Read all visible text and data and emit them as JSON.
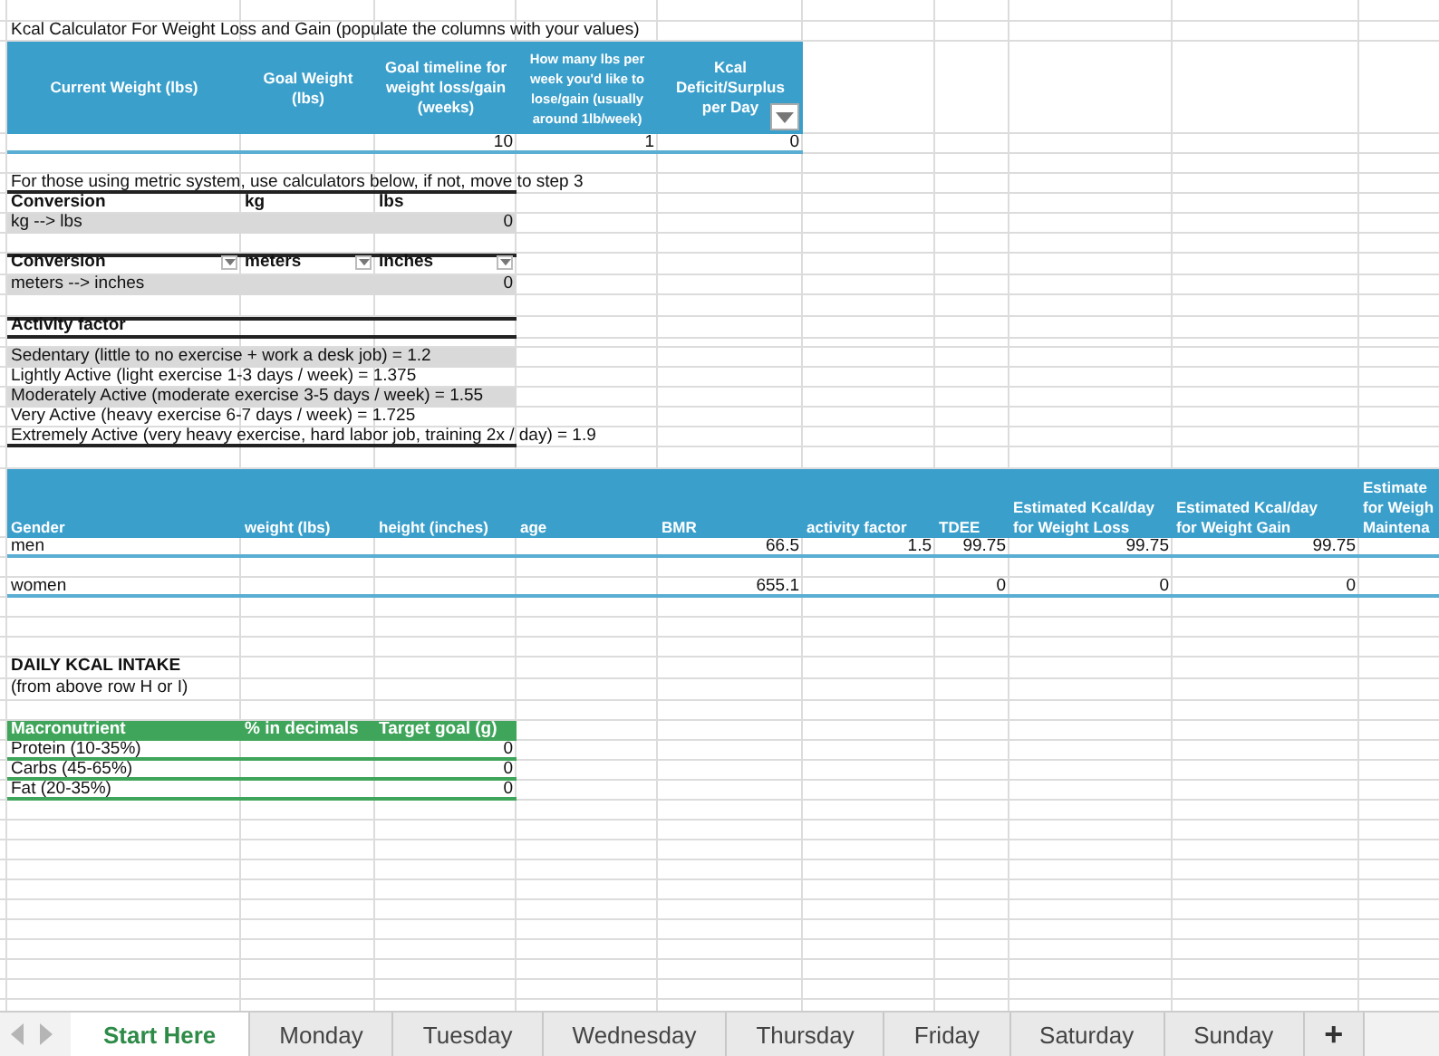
{
  "title": "Kcal Calculator For Weight Loss and Gain (populate the columns with your values)",
  "goal_table": {
    "columns": [
      {
        "label": "Current Weight (lbs)",
        "filter": false
      },
      {
        "label": "Goal Weight (lbs)",
        "filter": false
      },
      {
        "label": "Goal timeline for weight loss/gain (weeks)",
        "filter": false,
        "value": "10"
      },
      {
        "label": "How many lbs per week you'd like to lose/gain (usually around 1lb/week)",
        "filter": false,
        "value": "1"
      },
      {
        "label": "Kcal Deficit/Surplus per Day",
        "filter": true,
        "value": "0"
      }
    ]
  },
  "metric_note": "For those using metric system, use calculators below, if not, move to step 3",
  "conversions": [
    {
      "headers": [
        "Conversion",
        "kg",
        "lbs"
      ],
      "filters": false,
      "label": "kg --> lbs",
      "result": "0"
    },
    {
      "headers": [
        "Conversion",
        "meters",
        "inches"
      ],
      "filters": true,
      "label": "meters --> inches",
      "result": "0"
    }
  ],
  "activity": {
    "heading": "Activity factor",
    "levels": [
      {
        "text": "Sedentary (little to no exercise + work a desk job) = 1.2",
        "shaded": true
      },
      {
        "text": "Lightly Active (light exercise 1-3 days / week) = 1.375",
        "shaded": false
      },
      {
        "text": "Moderately Active (moderate exercise 3-5 days / week) = 1.55",
        "shaded": true
      },
      {
        "text": "Very Active (heavy exercise 6-7 days / week) = 1.725",
        "shaded": false
      },
      {
        "text": "Extremely Active (very heavy exercise, hard labor job, training 2x / day) = 1.9",
        "shaded": false
      }
    ]
  },
  "bmr_table": {
    "columns": [
      "Gender",
      "weight (lbs)",
      "height (inches)",
      "age",
      "BMR",
      "activity factor",
      "TDEE",
      "Estimated Kcal/day\nfor Weight Loss",
      "Estimated Kcal/day\nfor Weight Gain",
      "Estimate\nfor Weigh\nMaintena"
    ],
    "rows": [
      [
        "men",
        null,
        null,
        null,
        "66.5",
        "1.5",
        "99.75",
        "99.75",
        "99.75",
        null
      ],
      [
        "women",
        null,
        null,
        null,
        "655.1",
        null,
        "0",
        "0",
        "0",
        null
      ]
    ]
  },
  "daily_intake": {
    "heading": "DAILY KCAL INTAKE",
    "note": "(from above row H or I)"
  },
  "macros": {
    "columns": [
      "Macronutrient",
      "% in decimals",
      "Target goal (g)"
    ],
    "rows": [
      [
        "Protein (10-35%)",
        null,
        "0"
      ],
      [
        "Carbs (45-65%)",
        null,
        "0"
      ],
      [
        "Fat (20-35%)",
        null,
        "0"
      ]
    ]
  },
  "sheet_tabs": [
    {
      "label": "Start Here",
      "selected": true
    },
    {
      "label": "Monday",
      "selected": false
    },
    {
      "label": "Tuesday",
      "selected": false
    },
    {
      "label": "Wednesday",
      "selected": false
    },
    {
      "label": "Thursday",
      "selected": false
    },
    {
      "label": "Friday",
      "selected": false
    },
    {
      "label": "Saturday",
      "selected": false
    },
    {
      "label": "Sunday",
      "selected": false
    }
  ],
  "add_sheet": "+"
}
